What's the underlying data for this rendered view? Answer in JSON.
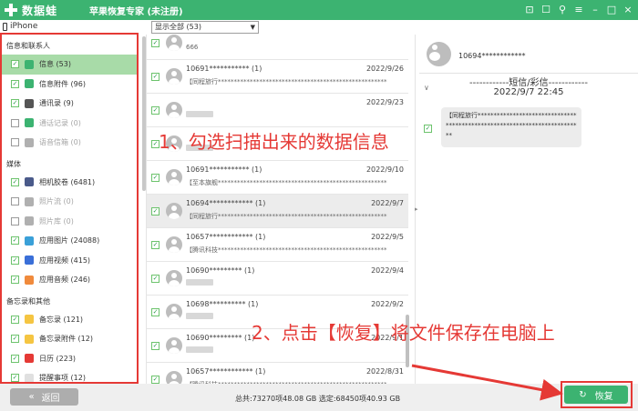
{
  "titlebar": {
    "logo_text": "数据蛙",
    "app_title": "苹果恢复专家 (未注册)",
    "buttons": [
      "gift",
      "chat",
      "user",
      "menu",
      "minimize",
      "maximize",
      "close"
    ]
  },
  "device": {
    "name": "iPhone"
  },
  "sidebar": {
    "sections": [
      {
        "title": "信息和联系人",
        "items": [
          {
            "label": "信息 (53)",
            "checked": true,
            "active": true,
            "icon": "message-icon",
            "color": "#3cb371"
          },
          {
            "label": "信息附件 (96)",
            "checked": true,
            "icon": "attachment-icon",
            "color": "#3cb371"
          },
          {
            "label": "通讯录 (9)",
            "checked": true,
            "icon": "contacts-icon",
            "color": "#555555"
          },
          {
            "label": "通话记录 (0)",
            "checked": false,
            "muted": true,
            "icon": "phone-icon",
            "color": "#3cb371"
          },
          {
            "label": "语音信箱 (0)",
            "checked": false,
            "muted": true,
            "icon": "voicemail-icon",
            "color": "#b0b0b0"
          }
        ]
      },
      {
        "title": "媒体",
        "items": [
          {
            "label": "相机胶卷 (6481)",
            "checked": true,
            "icon": "camera-icon",
            "color": "#4a5a8a"
          },
          {
            "label": "照片流 (0)",
            "checked": false,
            "muted": true,
            "icon": "photostream-icon",
            "color": "#b0b0b0"
          },
          {
            "label": "照片库 (0)",
            "checked": false,
            "muted": true,
            "icon": "photolibrary-icon",
            "color": "#b0b0b0"
          },
          {
            "label": "应用图片 (24088)",
            "checked": true,
            "icon": "app-photo-icon",
            "color": "#3aa0d8"
          },
          {
            "label": "应用视频 (415)",
            "checked": true,
            "icon": "app-video-icon",
            "color": "#3a6fd8"
          },
          {
            "label": "应用音频 (246)",
            "checked": true,
            "icon": "app-audio-icon",
            "color": "#f08a3c"
          }
        ]
      },
      {
        "title": "备忘录和其他",
        "items": [
          {
            "label": "备忘录 (121)",
            "checked": true,
            "icon": "notes-icon",
            "color": "#f5c542"
          },
          {
            "label": "备忘录附件 (12)",
            "checked": true,
            "icon": "notes-attachment-icon",
            "color": "#f5c542"
          },
          {
            "label": "日历 (223)",
            "checked": true,
            "icon": "calendar-icon",
            "color": "#e53935"
          },
          {
            "label": "提醒事项 (12)",
            "checked": true,
            "icon": "reminders-icon",
            "color": "#e0e0e0"
          }
        ]
      }
    ]
  },
  "filter": {
    "selected": "显示全部 (53)"
  },
  "messages": [
    {
      "title": "",
      "date": "",
      "preview": "666",
      "checked": true
    },
    {
      "title": "10691*********** (1)",
      "date": "2022/9/26",
      "preview": "【同程旅行*****************************************************",
      "checked": true
    },
    {
      "title": "",
      "date": "2022/9/23",
      "preview": "",
      "checked": true,
      "blurred": true
    },
    {
      "title": "",
      "date": "",
      "preview": "",
      "checked": true,
      "blurred": true
    },
    {
      "title": "10691*********** (1)",
      "date": "2022/9/10",
      "preview": "【至本旗舰*****************************************************",
      "checked": true
    },
    {
      "title": "10694************ (1)",
      "date": "2022/9/7",
      "preview": "【同程旅行*****************************************************",
      "checked": true,
      "selected": true
    },
    {
      "title": "10657************ (1)",
      "date": "2022/9/5",
      "preview": "【腾讯科技*****************************************************",
      "checked": true
    },
    {
      "title": "10690********* (1)",
      "date": "2022/9/4",
      "preview": "",
      "checked": true,
      "blurred": true
    },
    {
      "title": "10698********** (1)",
      "date": "2022/9/2",
      "preview": "",
      "checked": true,
      "blurred": true
    },
    {
      "title": "10690********* (1)",
      "date": "2022/9/1",
      "preview": "",
      "checked": true,
      "blurred": true
    },
    {
      "title": "10657************ (1)",
      "date": "2022/8/31",
      "preview": "【腾讯科技*****************************************************",
      "checked": true
    }
  ],
  "detail": {
    "contact": "10694************",
    "type_label": "------------短信/彩信------------",
    "time": "2022/9/7 22:45",
    "body": "【同程旅行**************************************************************************"
  },
  "bottom": {
    "back_label": "返回",
    "totals": "总共:73270项48.08 GB 选定:68450项40.93 GB",
    "recover_label": "恢复"
  },
  "annotations": {
    "step1": "1、勾选扫描出来的数据信息",
    "step2": "2、点击【恢复】将文件保存在电脑上",
    "color": "#e53935"
  },
  "colors": {
    "brand": "#3cb371",
    "active_row": "#a8dba8",
    "annotation": "#e53935"
  }
}
